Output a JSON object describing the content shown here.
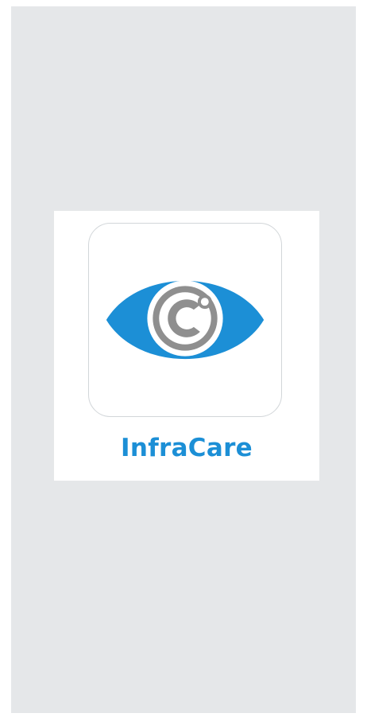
{
  "app": {
    "name": "InfraCare"
  },
  "icons": {
    "logo": "eye-c-logo-icon"
  },
  "colors": {
    "screen_background": "#e5e7e9",
    "card_background": "#ffffff",
    "brand_blue": "#1c8fd6",
    "logo_gray": "#8f8f8f"
  }
}
